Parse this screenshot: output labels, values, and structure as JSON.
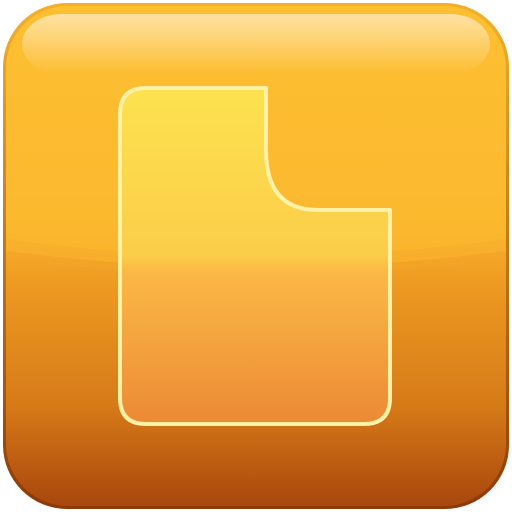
{
  "icon": {
    "name": "document-icon",
    "colors": {
      "tile_top": "#FDC233",
      "tile_mid": "#F4A92A",
      "tile_bottom": "#B2520F",
      "tile_border": "#D88A1C",
      "page_fill_top": "#FDE04F",
      "page_fill_bottom": "#EE8A33",
      "page_outline": "#FFF1A6"
    }
  }
}
